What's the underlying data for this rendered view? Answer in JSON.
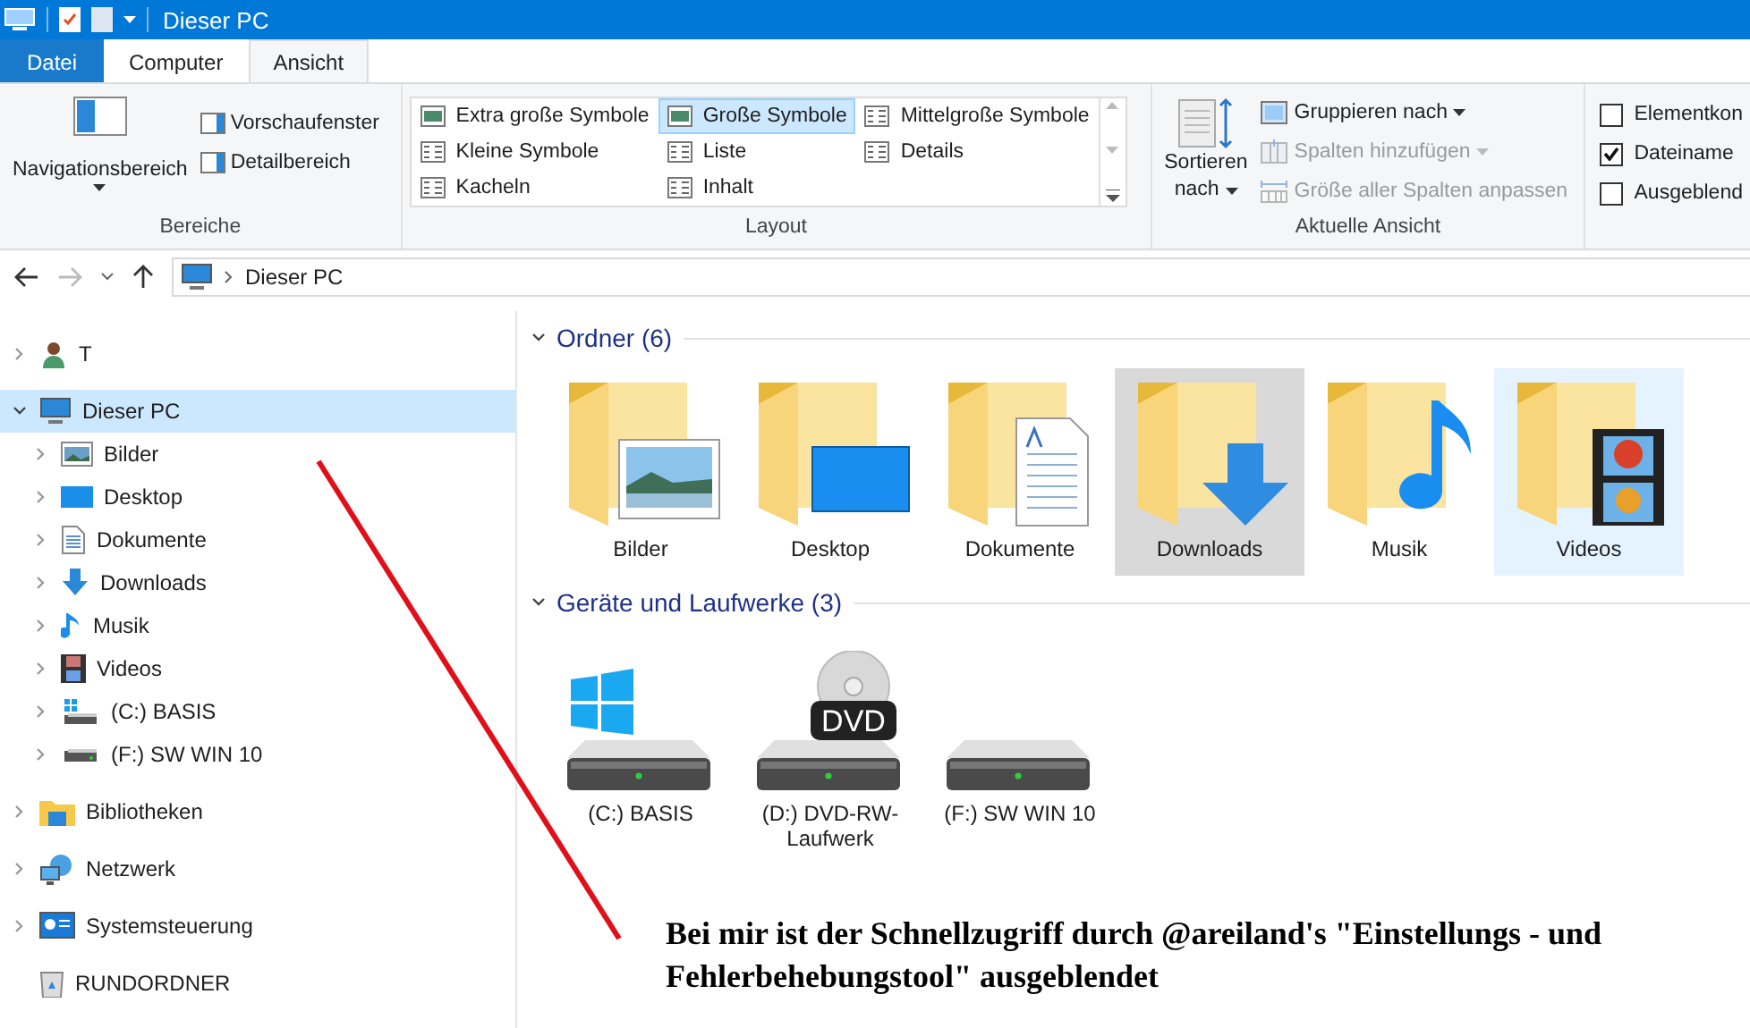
{
  "window": {
    "title": "Dieser PC"
  },
  "tabs": [
    {
      "label": "Datei",
      "kind": "file",
      "selected": false
    },
    {
      "label": "Computer",
      "kind": "tab",
      "selected": false
    },
    {
      "label": "Ansicht",
      "kind": "tab",
      "selected": true
    }
  ],
  "ribbon": {
    "panes": {
      "label": "Bereiche",
      "big": "Navigationsbereich",
      "items": [
        "Vorschaufenster",
        "Detailbereich"
      ]
    },
    "layout": {
      "label": "Layout",
      "options": [
        {
          "label": "Extra große Symbole",
          "kind": "xl",
          "selected": false
        },
        {
          "label": "Kleine Symbole",
          "kind": "small",
          "selected": false
        },
        {
          "label": "Kacheln",
          "kind": "tiles",
          "selected": false
        },
        {
          "label": "Große Symbole",
          "kind": "large",
          "selected": true
        },
        {
          "label": "Liste",
          "kind": "list",
          "selected": false
        },
        {
          "label": "Inhalt",
          "kind": "content",
          "selected": false
        },
        {
          "label": "Mittelgroße Symbole",
          "kind": "medium",
          "selected": false
        },
        {
          "label": "Details",
          "kind": "details",
          "selected": false
        }
      ]
    },
    "current_view": {
      "label": "Aktuelle Ansicht",
      "sort": [
        "Sortieren",
        "nach"
      ],
      "items": [
        {
          "label": "Gruppieren nach",
          "kind": "group",
          "disabled": false
        },
        {
          "label": "Spalten hinzufügen",
          "kind": "columns",
          "disabled": true
        },
        {
          "label": "Größe aller Spalten anpassen",
          "kind": "fit",
          "disabled": true
        }
      ]
    },
    "show_hide": [
      {
        "label": "Elementkon",
        "checked": false
      },
      {
        "label": "Dateiname",
        "checked": true
      },
      {
        "label": "Ausgeblend",
        "checked": false
      }
    ]
  },
  "address": {
    "path": "Dieser PC"
  },
  "nav": [
    {
      "label": "T",
      "kind": "user",
      "expanded": false,
      "selected": false
    },
    {
      "label": "Dieser PC",
      "kind": "pc",
      "expanded": true,
      "selected": true,
      "children": [
        {
          "label": "Bilder",
          "kind": "pictures",
          "expanded": false,
          "selected": false
        },
        {
          "label": "Desktop",
          "kind": "desktop",
          "expanded": false,
          "selected": false
        },
        {
          "label": "Dokumente",
          "kind": "documents",
          "expanded": false,
          "selected": false
        },
        {
          "label": "Downloads",
          "kind": "downloads",
          "expanded": false,
          "selected": false
        },
        {
          "label": "Musik",
          "kind": "music",
          "expanded": false,
          "selected": false
        },
        {
          "label": "Videos",
          "kind": "videos",
          "expanded": false,
          "selected": false
        },
        {
          "label": "(C:) BASIS",
          "kind": "windrive",
          "expanded": false,
          "selected": false
        },
        {
          "label": "(F:) SW WIN 10",
          "kind": "drive",
          "expanded": false,
          "selected": false
        }
      ]
    },
    {
      "label": "Bibliotheken",
      "kind": "libraries",
      "expanded": false,
      "selected": false
    },
    {
      "label": "Netzwerk",
      "kind": "network",
      "expanded": false,
      "selected": false
    },
    {
      "label": "Systemsteuerung",
      "kind": "control",
      "expanded": false,
      "selected": false
    },
    {
      "label": "RUNDORDNER",
      "kind": "recycle",
      "expanded": false,
      "selected": false,
      "leaf": true
    }
  ],
  "groups": [
    {
      "title": "Ordner (6)",
      "expanded": true,
      "items": [
        {
          "label": "Bilder",
          "kind": "pictures",
          "hovered": false,
          "selected": false
        },
        {
          "label": "Desktop",
          "kind": "desktop",
          "hovered": false,
          "selected": false
        },
        {
          "label": "Dokumente",
          "kind": "documents",
          "hovered": false,
          "selected": false
        },
        {
          "label": "Downloads",
          "kind": "downloads",
          "hovered": true,
          "selected": false
        },
        {
          "label": "Musik",
          "kind": "music",
          "hovered": false,
          "selected": false
        },
        {
          "label": "Videos",
          "kind": "videos",
          "hovered": false,
          "selected": true
        }
      ]
    },
    {
      "title": "Geräte und Laufwerke (3)",
      "expanded": true,
      "items": [
        {
          "label": "(C:) BASIS",
          "kind": "windrive",
          "hovered": false,
          "selected": false
        },
        {
          "label": "(D:) DVD-RW-Laufwerk",
          "kind": "dvd",
          "badge": "DVD",
          "hovered": false,
          "selected": false
        },
        {
          "label": "(F:) SW WIN 10",
          "kind": "drive",
          "hovered": false,
          "selected": false
        }
      ]
    }
  ],
  "annotation": {
    "text": "Bei mir ist der Schnellzugriff durch @areiland's \"Einstellungs - und Fehlerbehebungstool\" ausgeblendet"
  }
}
